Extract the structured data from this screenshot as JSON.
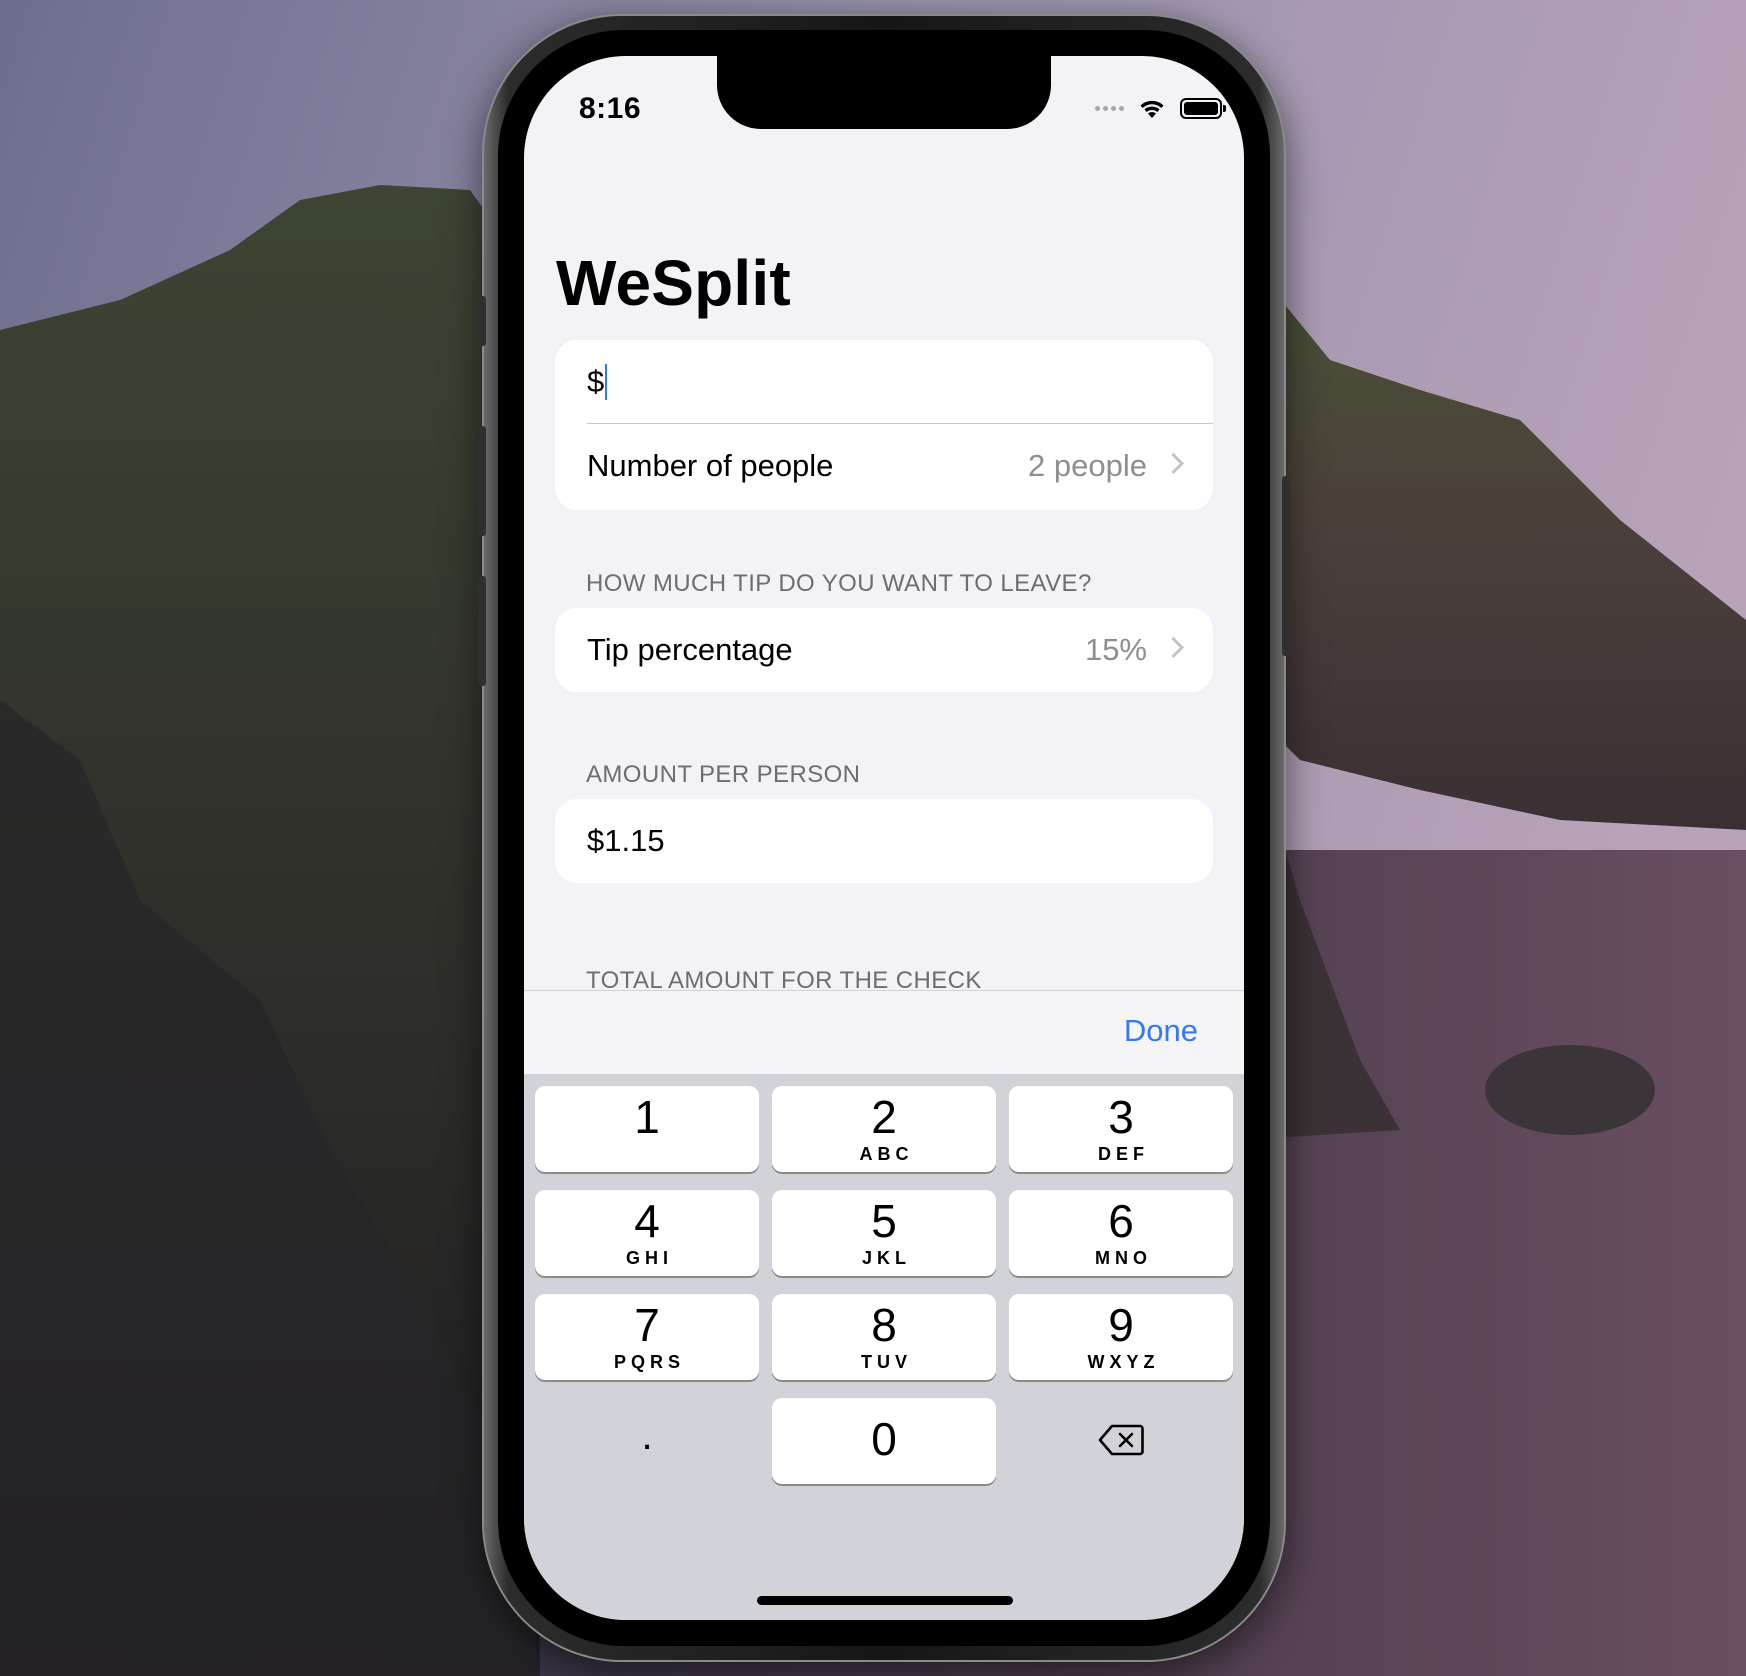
{
  "status_bar": {
    "time": "8:16"
  },
  "app": {
    "title": "WeSplit"
  },
  "form": {
    "amount_prefix": "$",
    "amount_value": "",
    "people_label": "Number of people",
    "people_value": "2 people",
    "tip_header": "HOW MUCH TIP DO YOU WANT TO LEAVE?",
    "tip_label": "Tip percentage",
    "tip_value": "15%",
    "amount_per_person_header": "AMOUNT PER PERSON",
    "amount_per_person_value": "$1.15",
    "total_header": "TOTAL AMOUNT FOR THE CHECK"
  },
  "keyboard": {
    "done_label": "Done",
    "keys": [
      {
        "digit": "1",
        "letters": ""
      },
      {
        "digit": "2",
        "letters": "ABC"
      },
      {
        "digit": "3",
        "letters": "DEF"
      },
      {
        "digit": "4",
        "letters": "GHI"
      },
      {
        "digit": "5",
        "letters": "JKL"
      },
      {
        "digit": "6",
        "letters": "MNO"
      },
      {
        "digit": "7",
        "letters": "PQRS"
      },
      {
        "digit": "8",
        "letters": "TUV"
      },
      {
        "digit": "9",
        "letters": "WXYZ"
      },
      {
        "digit": "0",
        "letters": ""
      }
    ],
    "decimal_label": "."
  },
  "icons": {
    "wifi": "wifi-icon",
    "battery": "battery-icon",
    "signal": "cellular-signal-icon",
    "chevron": "chevron-right-icon",
    "backspace": "delete-backspace-icon"
  },
  "colors": {
    "accent": "#3478f6",
    "background": "#f2f2f7",
    "keyboard": "#d1d3d9"
  }
}
